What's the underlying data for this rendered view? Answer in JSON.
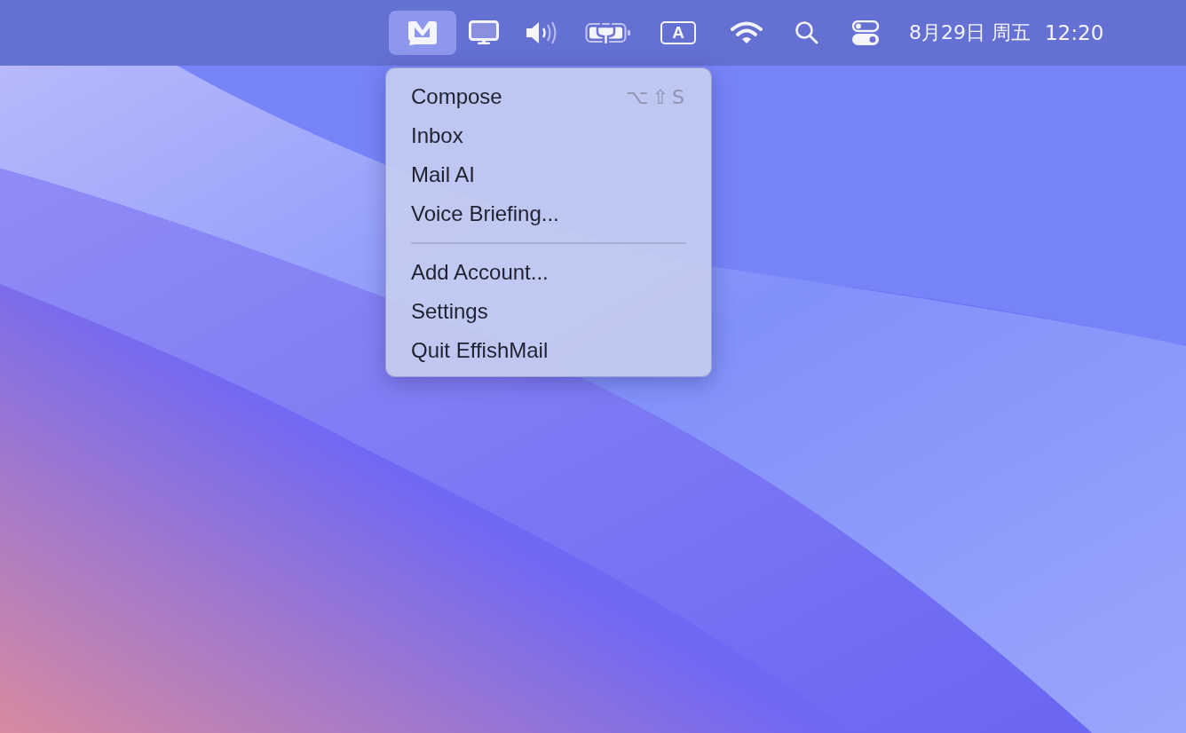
{
  "menu_bar": {
    "status_items": [
      {
        "kind": "mail",
        "selected": true
      },
      {
        "kind": "display",
        "selected": false
      },
      {
        "kind": "volume",
        "selected": false
      },
      {
        "kind": "battery",
        "selected": false
      },
      {
        "kind": "input",
        "label": "A",
        "selected": false
      },
      {
        "kind": "wifi",
        "selected": false
      },
      {
        "kind": "search",
        "selected": false
      },
      {
        "kind": "control",
        "selected": false
      }
    ],
    "date": "8月29日 周五",
    "time": "12:20"
  },
  "menu": {
    "groups": [
      {
        "items": [
          {
            "label": "Compose",
            "shortcut": "⌥⇧S"
          },
          {
            "label": "Inbox"
          },
          {
            "label": "Mail AI"
          },
          {
            "label": "Voice Briefing..."
          }
        ]
      },
      {
        "items": [
          {
            "label": "Add Account..."
          },
          {
            "label": "Settings"
          },
          {
            "label": "Quit EffishMail"
          }
        ]
      }
    ]
  }
}
